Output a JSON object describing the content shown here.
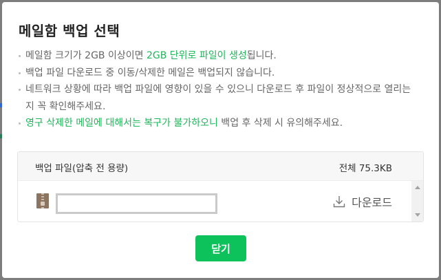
{
  "dialog": {
    "title": "메일함 백업 선택",
    "notes": [
      {
        "before": "메일함 크기가 2GB 이상이면 ",
        "highlight": "2GB 단위로 파일이 생성",
        "after": "됩니다."
      },
      {
        "before": "백업 파일 다운로드 중 이동/삭제한 메일은 백업되지 않습니다.",
        "highlight": "",
        "after": ""
      },
      {
        "before": "네트워크 상황에 따라 백업 파일에 영향이 있을 수 있으니 다운로드 후 파일이 정상적으로 열리는지 꼭 확인해주세요.",
        "highlight": "",
        "after": ""
      },
      {
        "before": "",
        "highlight": "영구 삭제한 메일에 대해서는 복구가 불가하오니",
        "after": " 백업 후 삭제 시 유의해주세요."
      }
    ],
    "panel": {
      "header_label": "백업 파일(압축 전 용량)",
      "total_size": "전체 75.3KB",
      "file": {
        "icon": "zip-file-icon",
        "name": "",
        "download_label": "다운로드",
        "download_icon": "download-icon"
      }
    },
    "close_label": "닫기"
  },
  "colors": {
    "accent": "#0dc25a",
    "highlight_text": "#1fb55a",
    "overlay": "#7d7d7d"
  }
}
